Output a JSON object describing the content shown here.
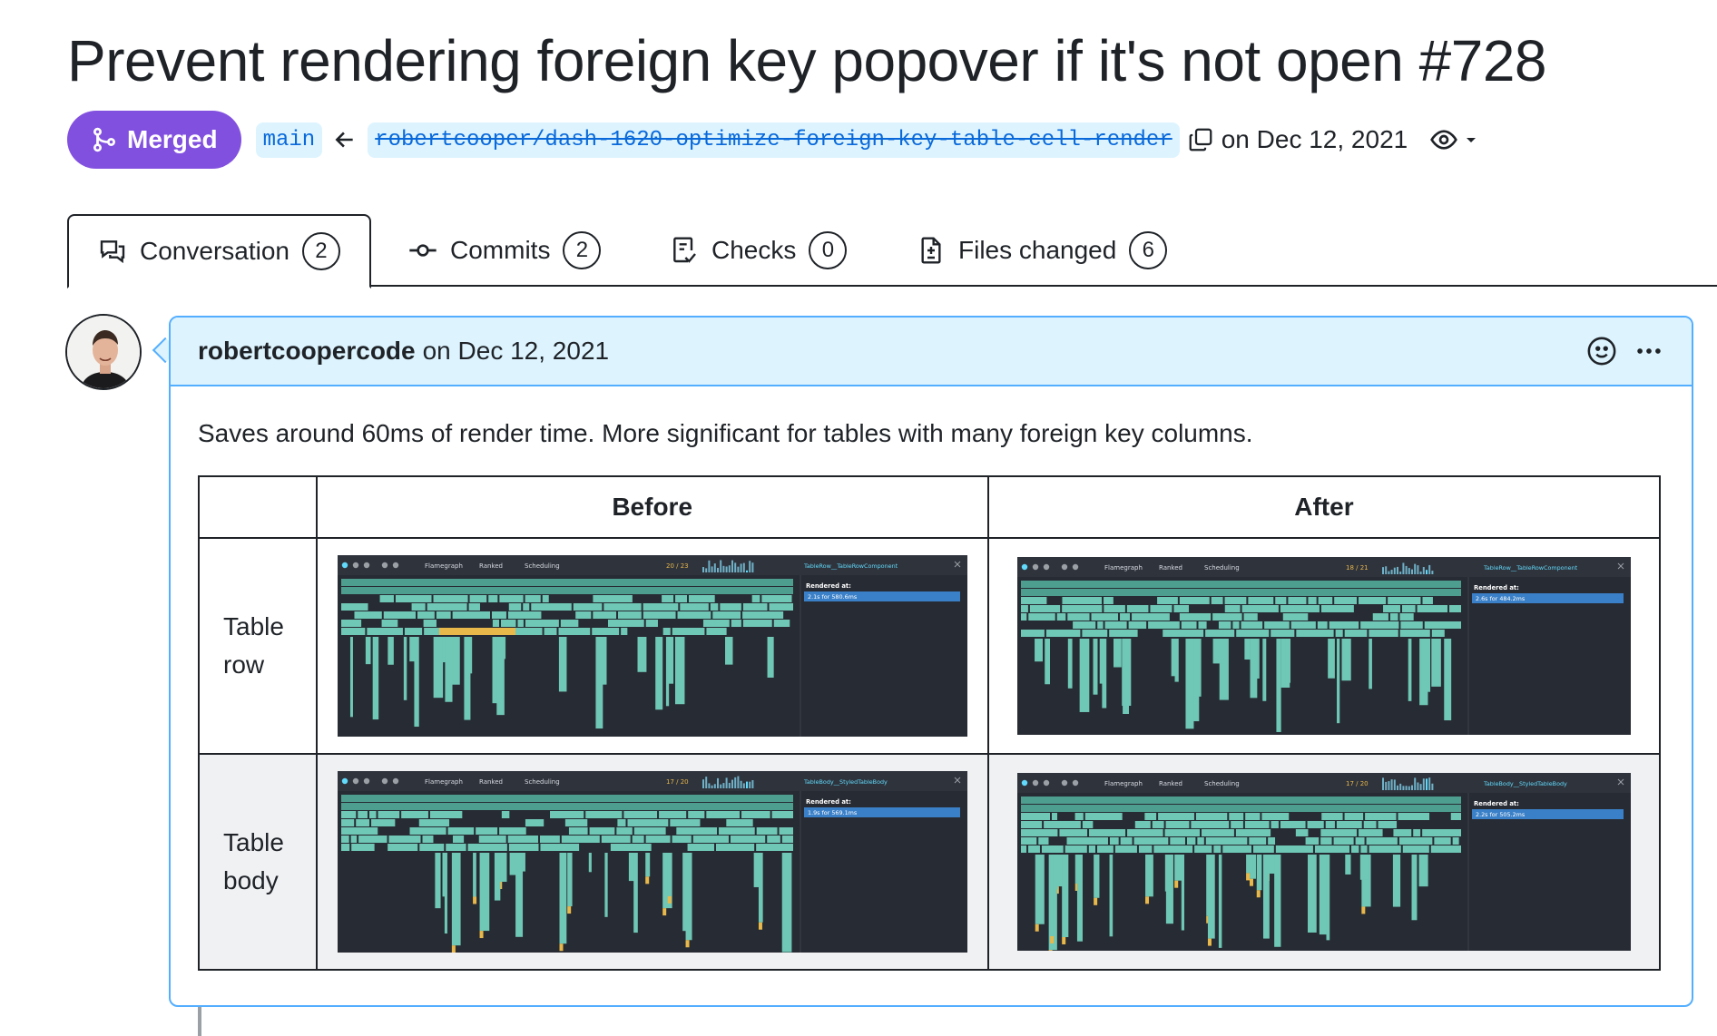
{
  "pr": {
    "title": "Prevent rendering foreign key popover if it's not open #728",
    "status": "Merged",
    "base_branch": "main",
    "head_branch": "robertcooper/dash-1620-optimize-foreign-key-table-cell-render",
    "merged_date": "on Dec 12, 2021"
  },
  "tabs": [
    {
      "label": "Conversation",
      "count": "2",
      "icon": "comment-discussion-icon"
    },
    {
      "label": "Commits",
      "count": "2",
      "icon": "git-commit-icon"
    },
    {
      "label": "Checks",
      "count": "0",
      "icon": "checklist-icon"
    },
    {
      "label": "Files changed",
      "count": "6",
      "icon": "file-diff-icon"
    }
  ],
  "comment": {
    "author": "robertcoopercode",
    "date": "on Dec 12, 2021",
    "body": "Saves around 60ms of render time. More significant for tables with many foreign key columns.",
    "table": {
      "headers": [
        "",
        "Before",
        "After"
      ],
      "rows": [
        {
          "label": "Table row"
        },
        {
          "label": "Table body"
        }
      ]
    }
  },
  "screenshots": [
    {
      "id": "before-row",
      "frame": "20 / 23",
      "component": "TableRow__TableRowComponent",
      "rendered": "2.1s for 580.6ms"
    },
    {
      "id": "after-row",
      "frame": "18 / 21",
      "component": "TableRow__TableRowComponent",
      "rendered": "2.6s for 484.2ms"
    },
    {
      "id": "before-body",
      "frame": "17 / 20",
      "component": "TableBody__StyledTableBody",
      "rendered": "1.9s for 569.1ms"
    },
    {
      "id": "after-body",
      "frame": "17 / 20",
      "component": "TableBody__StyledTableBody",
      "rendered": "2.2s for 505.2ms"
    }
  ],
  "colors": {
    "merged": "#8250df",
    "link": "#0969da",
    "comment_border": "#54aeff",
    "comment_header": "#ddf4ff",
    "devtools_bg": "#272b33",
    "flame_bar": "#6fc7b5",
    "flame_highlight": "#e8b84a"
  }
}
